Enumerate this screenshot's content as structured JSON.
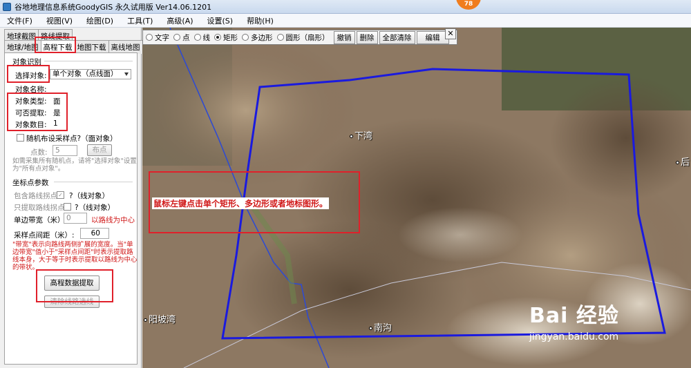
{
  "window": {
    "title": "谷地地理信息系统GoodyGIS 永久试用版 Ver14.06.1201",
    "badge": "78"
  },
  "menu": [
    "文件(F)",
    "视图(V)",
    "绘图(D)",
    "工具(T)",
    "高级(A)",
    "设置(S)",
    "帮助(H)"
  ],
  "tabs_row1": [
    "地球截图",
    "路线提取"
  ],
  "tabs_row2": [
    "地球/地图",
    "高程下载",
    "地图下载",
    "离线地图"
  ],
  "panel": {
    "group_object": "对象识别",
    "select_label": "选择对象:",
    "select_value": "单个对象（点线面）",
    "object_name_label": "对象名称:",
    "object_type_label": "对象类型:",
    "object_type_value": "面",
    "extractable_label": "可否提取:",
    "extractable_value": "是",
    "object_count_label": "对象数目:",
    "object_count_value": "1",
    "random_sample_label": "随机布设采样点?（面对象）",
    "points_label": "点数:",
    "points_value": "5",
    "place_points_button": "布点",
    "random_hint": "如需采集所有随机点，请将\"选择对象\"设置为\"所有点对象\"。",
    "group_coords": "坐标点参数",
    "include_inflection_label": "包含路线拐点",
    "include_inflection_hint": "?（线对象）",
    "only_inflection_label": "只提取路线拐点",
    "only_inflection_hint": "?（线对象）",
    "buffer_label": "单边带宽（米）:",
    "buffer_value": "0",
    "buffer_hint": "以路线为中心",
    "interval_label": "采样点间距（米）:",
    "interval_value": "60",
    "explanation": "\"带宽\"表示向路线两侧扩展的宽度。当\"单边带宽\"值小于\"采样点间距\"时表示提取路线本身，大于等于时表示提取以路线为中心的带状。",
    "extract_button": "高程数据提取",
    "route_button": "清除线路选线"
  },
  "toolbar": {
    "radios": [
      "文字",
      "点",
      "线",
      "矩形",
      "多边形",
      "圆形（扇形）"
    ],
    "selected_radio": "矩形",
    "buttons": [
      "撤销",
      "删除",
      "全部清除",
      "编辑"
    ],
    "close_label": "✕"
  },
  "map": {
    "places": [
      "下湾",
      "后",
      "阳坡湾",
      "南沟"
    ],
    "annotation": "鼠标左键点击单个矩形、多边形或者地标图形。",
    "polygon_color": "#1a1adf"
  },
  "watermark": {
    "brand": "Bai 经验",
    "url": "jingyan.baidu.com"
  }
}
